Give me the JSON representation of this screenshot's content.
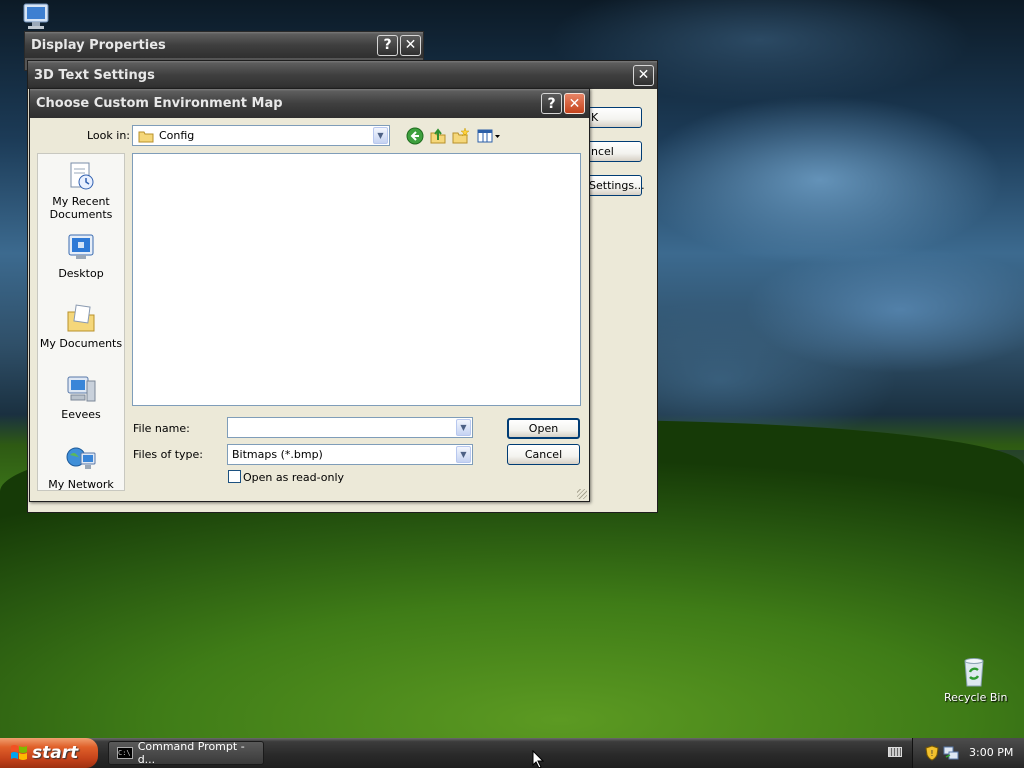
{
  "desktop": {
    "recycle_bin_label": "Recycle Bin"
  },
  "windows": {
    "display_properties": {
      "title": "Display Properties",
      "help_glyph": "?",
      "close_glyph": "✕"
    },
    "text3d_settings": {
      "title": "3D Text Settings",
      "close_glyph": "✕",
      "ok_label": "K",
      "cancel_label": "ncel",
      "settings_label": "Settings..."
    },
    "choose_env_map": {
      "title": "Choose Custom Environment Map",
      "help_glyph": "?",
      "close_glyph": "✕",
      "look_in_label": "Look in:",
      "look_in_value": "Config",
      "places": [
        {
          "label_line1": "My Recent",
          "label_line2": "Documents",
          "icon": "recent-documents-icon"
        },
        {
          "label_line1": "Desktop",
          "label_line2": "",
          "icon": "desktop-icon"
        },
        {
          "label_line1": "My Documents",
          "label_line2": "",
          "icon": "my-documents-icon"
        },
        {
          "label_line1": "Eevees",
          "label_line2": "",
          "icon": "computer-icon"
        },
        {
          "label_line1": "My Network",
          "label_line2": "",
          "icon": "network-icon"
        }
      ],
      "file_name_label": "File name:",
      "file_name_value": "",
      "files_of_type_label": "Files of type:",
      "files_of_type_value": "Bitmaps (*.bmp)",
      "read_only_label": "Open as read-only",
      "read_only_checked": false,
      "open_label": "Open",
      "cancel_label": "Cancel"
    }
  },
  "taskbar": {
    "start_label": "start",
    "items": [
      {
        "label": "Command Prompt - d..."
      }
    ],
    "clock": "3:00 PM"
  },
  "colors": {
    "title_bar": "#3f3f3f",
    "dialog_bg": "#ece9d8",
    "start_button": "#e0602a",
    "close_button": "#c4431c"
  }
}
